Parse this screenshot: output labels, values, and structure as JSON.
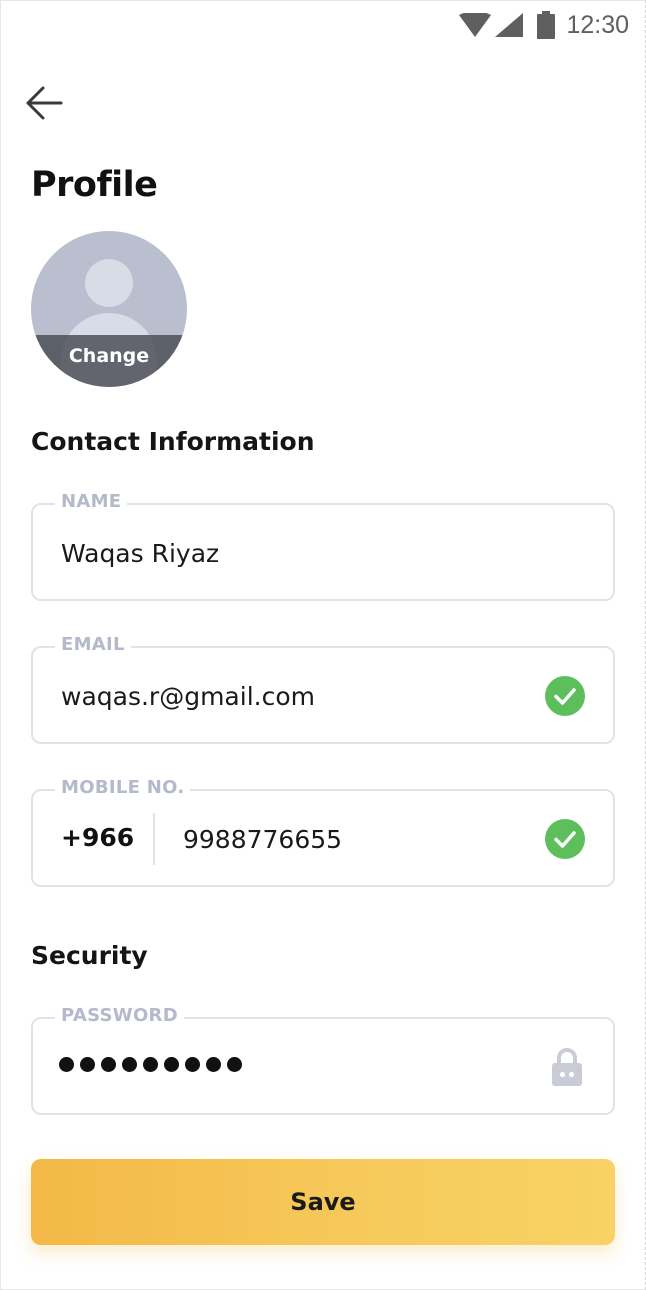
{
  "status_bar": {
    "time": "12:30",
    "icons": [
      "wifi-icon",
      "cellular-signal-icon",
      "battery-icon"
    ]
  },
  "header": {
    "back_icon": "arrow-left-icon",
    "title": "Profile"
  },
  "avatar": {
    "placeholder_icon": "person-placeholder-icon",
    "change_label": "Change"
  },
  "contact_section": {
    "title": "Contact Information",
    "fields": {
      "name": {
        "label": "NAME",
        "value": "Waqas Riyaz"
      },
      "email": {
        "label": "EMAIL",
        "value": "waqas.r@gmail.com",
        "verified_icon": "check-circle-icon"
      },
      "mobile": {
        "label": "MOBILE NO.",
        "country_code": "+966",
        "value": "9988776655",
        "verified_icon": "check-circle-icon"
      }
    }
  },
  "security_section": {
    "title": "Security",
    "password": {
      "label": "PASSWORD",
      "dot_count": 9,
      "lock_icon": "lock-icon"
    }
  },
  "save_button": {
    "label": "Save"
  },
  "colors": {
    "accent_start": "#f3b847",
    "accent_end": "#f8d265",
    "verified_green": "#5cbf5c",
    "label_gray": "#b4b9cc",
    "border_gray": "#e2e3ea"
  }
}
